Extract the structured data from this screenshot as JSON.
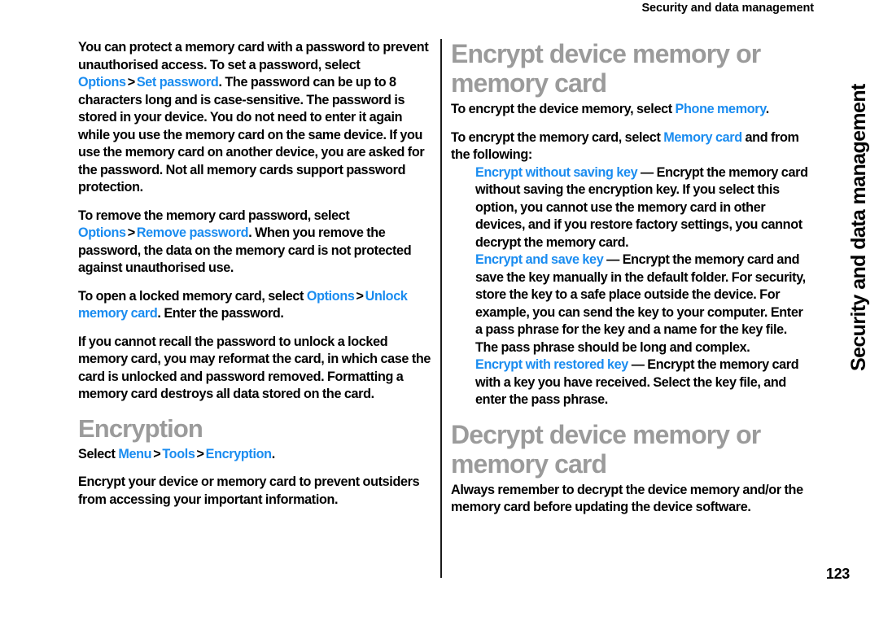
{
  "header": {
    "running_title": "Security and data management"
  },
  "side_tab": {
    "label": "Security and data management"
  },
  "page_number": "123",
  "colors": {
    "link": "#1a8cf0",
    "heading": "#9b9b9b",
    "body": "#000000",
    "divider": "#1a1a1a",
    "background": "#ffffff"
  },
  "left_column": {
    "p1": {
      "t1": "You can protect a memory card with a password to prevent unauthorised access. To set a password, select ",
      "link1": "Options",
      "sep1": ">",
      "link2": "Set password",
      "t2": ". The password can be up to 8 characters long and is case-sensitive. The password is stored in your device. You do not need to enter it again while you use the memory card on the same device. If you use the memory card on another device, you are asked for the password. Not all memory cards support password protection."
    },
    "p2": {
      "t1": "To remove the memory card password, select ",
      "link1": "Options",
      "sep1": ">",
      "link2": "Remove password",
      "t2": ". When you remove the password, the data on the memory card is not protected against unauthorised use."
    },
    "p3": {
      "t1": "To open a locked memory card, select ",
      "link1": "Options",
      "sep1": ">",
      "link2": "Unlock memory card",
      "t2": ". Enter the password."
    },
    "p4": {
      "t1": "If you cannot recall the password to unlock a locked memory card, you may reformat the card, in which case the card is unlocked and password removed. Formatting a memory card destroys all data stored on the card."
    },
    "heading_encryption": "Encryption",
    "p5": {
      "t1": "Select ",
      "link1": "Menu",
      "sep1": ">",
      "link2": "Tools",
      "sep2": ">",
      "link3": "Encryption",
      "t2": "."
    },
    "p6": {
      "t1": "Encrypt your device or memory card to prevent outsiders from accessing your important information."
    }
  },
  "right_column": {
    "heading_encrypt": "Encrypt device memory or memory card",
    "p1": {
      "t1": "To encrypt the device memory, select ",
      "link1": "Phone memory",
      "t2": "."
    },
    "p2": {
      "t1": "To encrypt the memory card, select ",
      "link1": "Memory card",
      "t2": " and from the following:"
    },
    "options": [
      {
        "name": "Encrypt without saving key",
        "dash": "—",
        "description": " Encrypt the memory card without saving the encryption key. If you select this option, you cannot use the memory card in other devices, and if you restore factory settings, you cannot decrypt the memory card."
      },
      {
        "name": "Encrypt and save key",
        "dash": "—",
        "description": " Encrypt the memory card and save the key manually in the default folder. For security, store the key to a safe place outside the device. For example, you can send the key to your computer. Enter a pass phrase for the key and a name for the key file. The pass phrase should be long and complex."
      },
      {
        "name": "Encrypt with restored key",
        "dash": "—",
        "description": " Encrypt the memory card with a key you have received. Select the key file, and enter the pass phrase."
      }
    ],
    "heading_decrypt": "Decrypt device memory or memory card",
    "p3": {
      "t1": "Always remember to decrypt the device memory and/or the memory card before updating the device software."
    }
  }
}
